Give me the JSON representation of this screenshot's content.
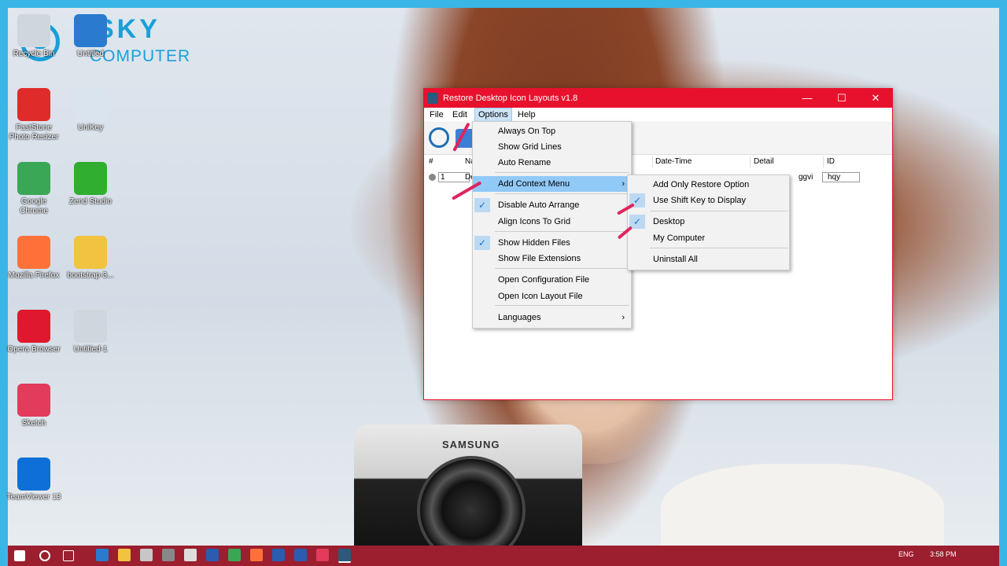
{
  "logo": {
    "brand": "SKY",
    "sub": "COMPUTER"
  },
  "desktop": {
    "icons": [
      {
        "label": "Recycle Bin",
        "color": "#cfd6dd"
      },
      {
        "label": "Untitled",
        "color": "#2a7ad0"
      },
      {
        "label": "FastStone Photo Resizer",
        "color": "#e02b2b"
      },
      {
        "label": "UniKey",
        "color": "#d9e4ef"
      },
      {
        "label": "Google Chrome",
        "color": "#3aa757"
      },
      {
        "label": "Zend Studio",
        "color": "#2fae2f"
      },
      {
        "label": "Mozilla Firefox",
        "color": "#ff7139"
      },
      {
        "label": "bootstrap-3...",
        "color": "#f1c340"
      },
      {
        "label": "Opera Browser",
        "color": "#e0182d"
      },
      {
        "label": "Untitled-1",
        "color": "#cfd6dd"
      },
      {
        "label": "Sketch",
        "color": "#e23b5b"
      },
      {
        "label": "TeamViewer 13",
        "color": "#0e6fd8"
      }
    ],
    "camera_brand": "SAMSUNG"
  },
  "window": {
    "title": "Restore Desktop Icon Layouts v1.8",
    "controls": {
      "minimize": "—",
      "maximize": "☐",
      "close": "✕"
    },
    "menubar": [
      "File",
      "Edit",
      "Options",
      "Help"
    ],
    "columns": [
      "#",
      "Na",
      "Date-Time",
      "Detail",
      "ID"
    ],
    "row": {
      "num": "1",
      "name": "De",
      "detail": "ggvi",
      "id": "hqy"
    }
  },
  "options_menu": [
    {
      "label": "Always On Top",
      "checked": false
    },
    {
      "label": "Show Grid Lines",
      "checked": false
    },
    {
      "label": "Auto Rename",
      "checked": false
    },
    {
      "label": "Add Context Menu",
      "checked": false,
      "submenu": true,
      "highlighted": true
    },
    {
      "label": "Disable Auto Arrange",
      "checked": true
    },
    {
      "label": "Align Icons To Grid",
      "checked": false
    },
    {
      "label": "Show Hidden Files",
      "checked": true
    },
    {
      "label": "Show File Extensions",
      "checked": false
    },
    {
      "label": "Open Configuration File",
      "checked": false
    },
    {
      "label": "Open Icon Layout File",
      "checked": false
    },
    {
      "label": "Languages",
      "checked": false,
      "submenu": true
    }
  ],
  "context_submenu": [
    {
      "label": "Add Only Restore Option",
      "checked": false
    },
    {
      "label": "Use Shift Key to Display",
      "checked": true
    },
    {
      "label": "Desktop",
      "checked": true
    },
    {
      "label": "My Computer",
      "checked": false
    },
    {
      "label": "Uninstall All",
      "checked": false
    }
  ],
  "checkmark": "✓",
  "submenu_arrow": "›",
  "taskbar": {
    "lang": "ENG",
    "time": "3:58 PM"
  }
}
